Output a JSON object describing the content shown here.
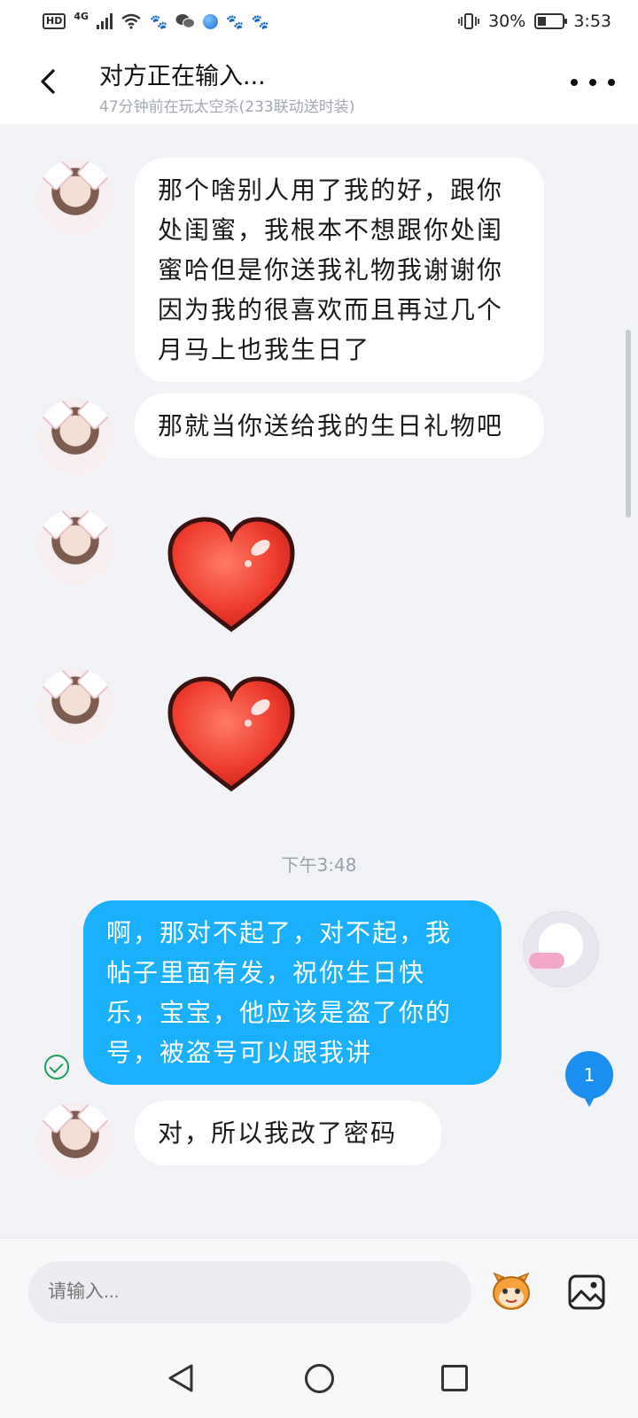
{
  "status_bar": {
    "hd": "HD",
    "network": "4G",
    "battery_percent": "30%",
    "time": "3:53"
  },
  "header": {
    "title": "对方正在输入...",
    "subtitle": "47分钟前在玩太空杀(233联动送时装)"
  },
  "messages": [
    {
      "from": "other",
      "type": "text",
      "lines": [
        "那个啥别人用了我的好，跟你",
        "处闺蜜，我根本不想跟你处闺",
        "蜜哈但是你送我礼物我谢谢你",
        "因为我的很喜欢而且再过几个",
        "月马上也我生日了"
      ]
    },
    {
      "from": "other",
      "type": "text",
      "lines": [
        "那就当你送给我的生日礼物吧"
      ]
    },
    {
      "from": "other",
      "type": "sticker",
      "icon": "heart-sticker"
    },
    {
      "from": "other",
      "type": "sticker",
      "icon": "heart-sticker"
    },
    {
      "type": "timestamp",
      "text": "下午3:48"
    },
    {
      "from": "me",
      "type": "text",
      "status": "read",
      "lines": [
        "啊，那对不起了，对不起，我",
        "帖子里面有发，祝你生日快",
        "乐，宝宝，他应该是盗了你的",
        "号，被盗号可以跟我讲"
      ]
    },
    {
      "from": "other",
      "type": "text",
      "lines": [
        "对，所以我改了密码"
      ]
    }
  ],
  "unread_count": "1",
  "input": {
    "placeholder": "请输入..."
  },
  "colors": {
    "my_bubble": "#1bb0fb",
    "their_bubble": "#ffffff",
    "background": "#f2f3f7",
    "read_check": "#1a9e5a",
    "unread_badge": "#1a8ff0"
  }
}
